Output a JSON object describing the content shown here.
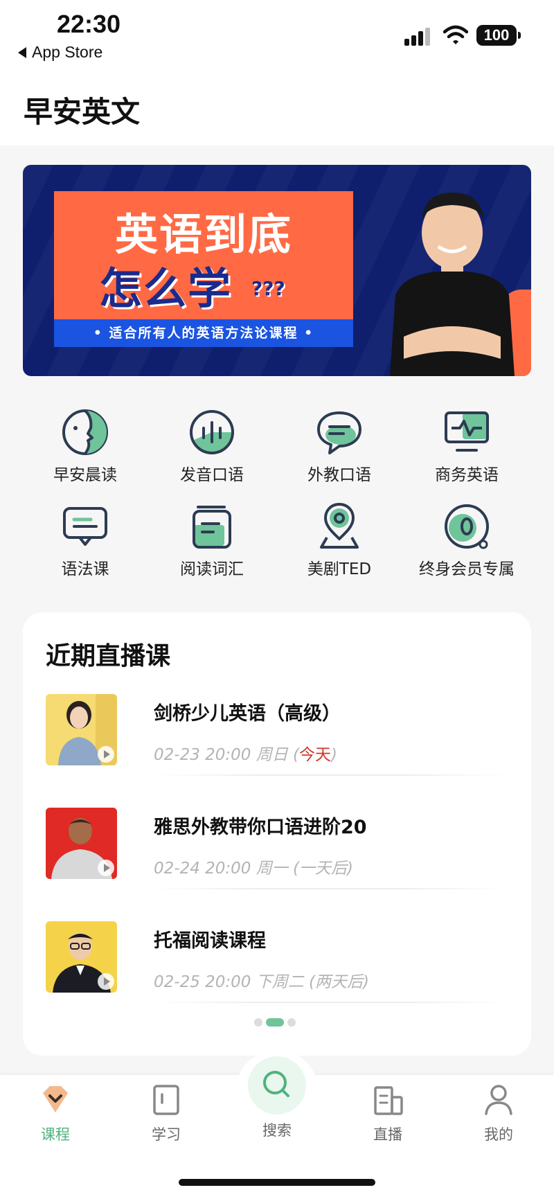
{
  "status_bar": {
    "time": "22:30",
    "back_label": "App Store",
    "battery": "100"
  },
  "header": {
    "title": "早安英文"
  },
  "banner": {
    "line1": "英语到底",
    "line2": "怎么学",
    "question_marks": "???",
    "subtitle": "• 适合所有人的英语方法论课程 •",
    "colors": {
      "navy": "#0f1f6e",
      "orange": "#ff6a45",
      "blue": "#1a54e0"
    }
  },
  "categories": [
    {
      "label": "早安晨读",
      "icon": "face-profile-icon"
    },
    {
      "label": "发音口语",
      "icon": "sound-wave-icon"
    },
    {
      "label": "外教口语",
      "icon": "chat-bubble-icon"
    },
    {
      "label": "商务英语",
      "icon": "monitor-pulse-icon"
    },
    {
      "label": "语法课",
      "icon": "message-lines-icon"
    },
    {
      "label": "阅读词汇",
      "icon": "book-stack-icon"
    },
    {
      "label": "美剧TED",
      "icon": "location-pin-icon"
    },
    {
      "label": "终身会员专属",
      "icon": "zero-badge-icon"
    }
  ],
  "live": {
    "title": "近期直播课",
    "items": [
      {
        "name": "剑桥少儿英语（高级）",
        "time": "02-23 20:00 周日 (",
        "note": "今天",
        "close": ")"
      },
      {
        "name": "雅思外教带你口语进阶20",
        "time": "02-24 20:00 周一 (一天后)"
      },
      {
        "name": "托福阅读课程",
        "time": "02-25 20:00 下周二 (两天后)"
      }
    ],
    "page_count": 3,
    "active_page": 2
  },
  "tabbar": {
    "items": [
      {
        "label": "课程",
        "icon": "course-icon"
      },
      {
        "label": "学习",
        "icon": "study-icon"
      },
      {
        "label": "搜索",
        "icon": "search-icon"
      },
      {
        "label": "直播",
        "icon": "live-icon"
      },
      {
        "label": "我的",
        "icon": "profile-icon"
      }
    ],
    "active_color": "#4fb27f"
  }
}
